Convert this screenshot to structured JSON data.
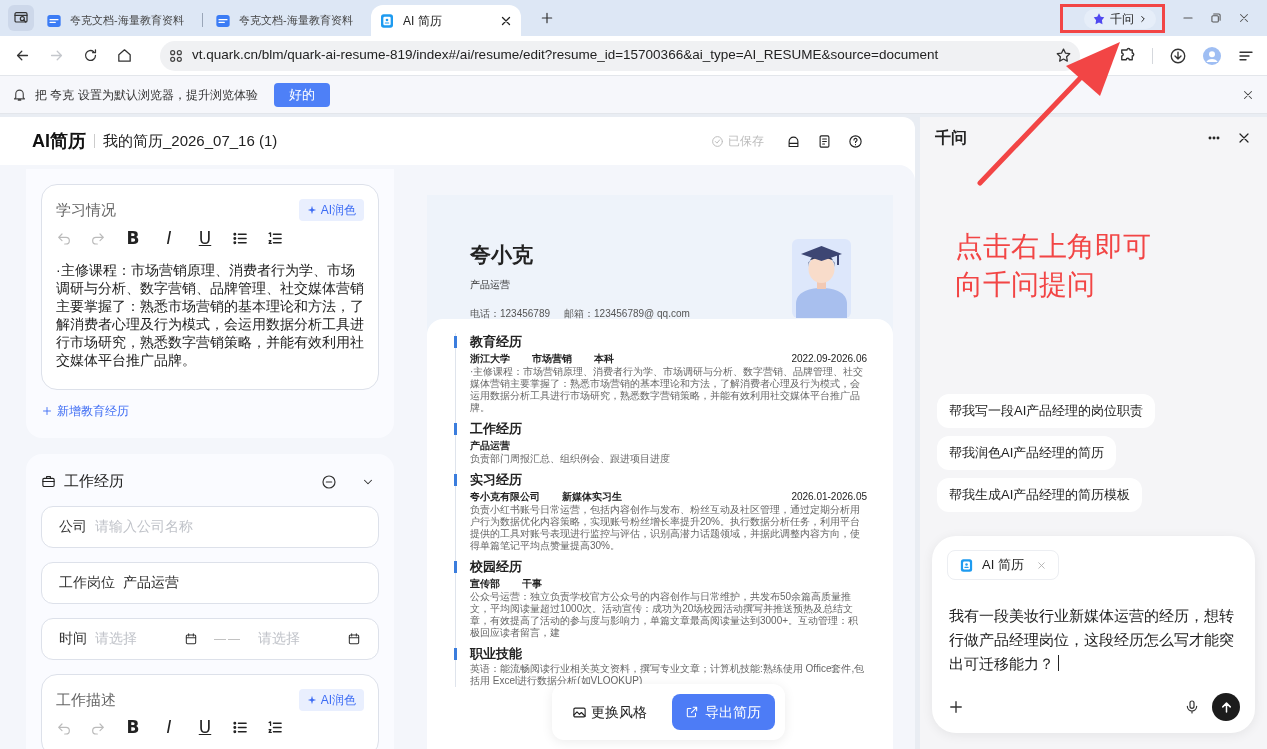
{
  "browser": {
    "tabs": [
      {
        "title": "夸克文档-海量教育资料",
        "kind": "doc",
        "selected": false
      },
      {
        "title": "夸克文档-海量教育资料",
        "kind": "doc",
        "selected": false
      },
      {
        "title": "AI 简历",
        "kind": "resume",
        "selected": true
      }
    ],
    "assistant_button": {
      "label": "千问"
    },
    "nav_buttons": [
      {
        "kind": "back",
        "disabled": false
      },
      {
        "kind": "forward",
        "disabled": true
      },
      {
        "kind": "reload",
        "disabled": false
      },
      {
        "kind": "home",
        "disabled": false
      }
    ],
    "url": "vt.quark.cn/blm/quark-ai-resume-819/index#/ai/resume/edit?resume_id=15700366&ai_type=AI_RESUME&source=document",
    "notification": {
      "message": "把 夸克 设置为默认浏览器，提升浏览体验",
      "button": "好的"
    }
  },
  "app": {
    "logo": "AI简历",
    "document_title": "我的简历_2026_07_16 (1)",
    "save_status": "已保存"
  },
  "editor": {
    "education_card": {
      "field_label": "学习情况",
      "ai_button": "AI润色",
      "format_buttons": [
        "B",
        "I",
        "U"
      ],
      "content": "·主修课程：市场营销原理、消费者行为学、市场调研与分析、数字营销、品牌管理、社交媒体营销主要掌握了：熟悉市场营销的基本理论和方法，了解消费者心理及行为模式，会运用数据分析工具进行市场研究，熟悉数字营销策略，并能有效利用社交媒体平台推广品牌。",
      "add_link": "新增教育经历"
    },
    "work_section": {
      "title": "工作经历",
      "fields": [
        {
          "label": "公司",
          "placeholder": "请输入公司名称"
        },
        {
          "label": "工作岗位",
          "value": "产品运营"
        }
      ],
      "time": {
        "label": "时间",
        "start_placeholder": "请选择",
        "separator": "——",
        "end_placeholder": "请选择"
      },
      "description": {
        "label": "工作描述",
        "ai_button": "AI润色",
        "format_buttons": [
          "B",
          "I",
          "U"
        ]
      }
    }
  },
  "preview": {
    "name": "夸小克",
    "role": "产品运营",
    "contacts": [
      "电话：123456789",
      "邮箱：123456789@ qq.com"
    ],
    "sections": [
      {
        "title": "教育经历",
        "meta": [
          "浙江大学",
          "市场营销",
          "本科"
        ],
        "date": "2022.09-2026.06",
        "description": "·主修课程：市场营销原理、消费者行为学、市场调研与分析、数字营销、品牌管理、社交媒体营销主要掌握了：熟悉市场营销的基本理论和方法，了解消费者心理及行为模式，会运用数据分析工具进行市场研究，熟悉数字营销策略，并能有效利用社交媒体平台推广品牌。"
      },
      {
        "title": "工作经历",
        "meta": [
          "产品运营"
        ],
        "description": "负责部门周报汇总、组织例会、跟进项目进度"
      },
      {
        "title": "实习经历",
        "meta": [
          "夸小克有限公司",
          "新媒体实习生"
        ],
        "date": "2026.01-2026.05",
        "description": "负责小红书账号日常运营，包括内容创作与发布、粉丝互动及社区管理，通过定期分析用户行为数据优化内容策略，实现账号粉丝增长率提升20%。执行数据分析任务，利用平台提供的工具对账号表现进行监控与评估，识别高潜力话题领域，并据此调整内容方向，使得单篇笔记平均点赞量提高30%。"
      },
      {
        "title": "校园经历",
        "meta": [
          "宣传部",
          "干事"
        ],
        "description": "公众号运营：独立负责学校官方公众号的内容创作与日常维护，共发布50余篇高质量推文，平均阅读量超过1000次。活动宣传：成功为20场校园活动撰写并推送预热及总结文章，有效提高了活动的参与度与影响力，单篇文章最高阅读量达到3000+。互动管理：积极回应读者留言，建"
      },
      {
        "title": "职业技能",
        "description": "英语：能流畅阅读行业相关英文资料，撰写专业文章；计算机技能:熟练使用 Office套件,包括用 Excel进行数据分析(如VLOOKUP)"
      }
    ]
  },
  "preview_actions": [
    {
      "label": "更换风格",
      "kind": "style"
    },
    {
      "label": "导出简历",
      "kind": "export"
    }
  ],
  "assistant_panel": {
    "title": "千问",
    "suggestions": [
      "帮我写一段AI产品经理的岗位职责",
      "帮我润色AI产品经理的简历",
      "帮我生成AI产品经理的简历模板"
    ],
    "composer": {
      "attachment": "AI 简历",
      "value": "我有一段美妆行业新媒体运营的经历，想转行做产品经理岗位，这段经历怎么写才能突出可迁移能力？"
    }
  },
  "annotation": {
    "lines": [
      "点击右上角即可",
      "向千问提问"
    ]
  }
}
